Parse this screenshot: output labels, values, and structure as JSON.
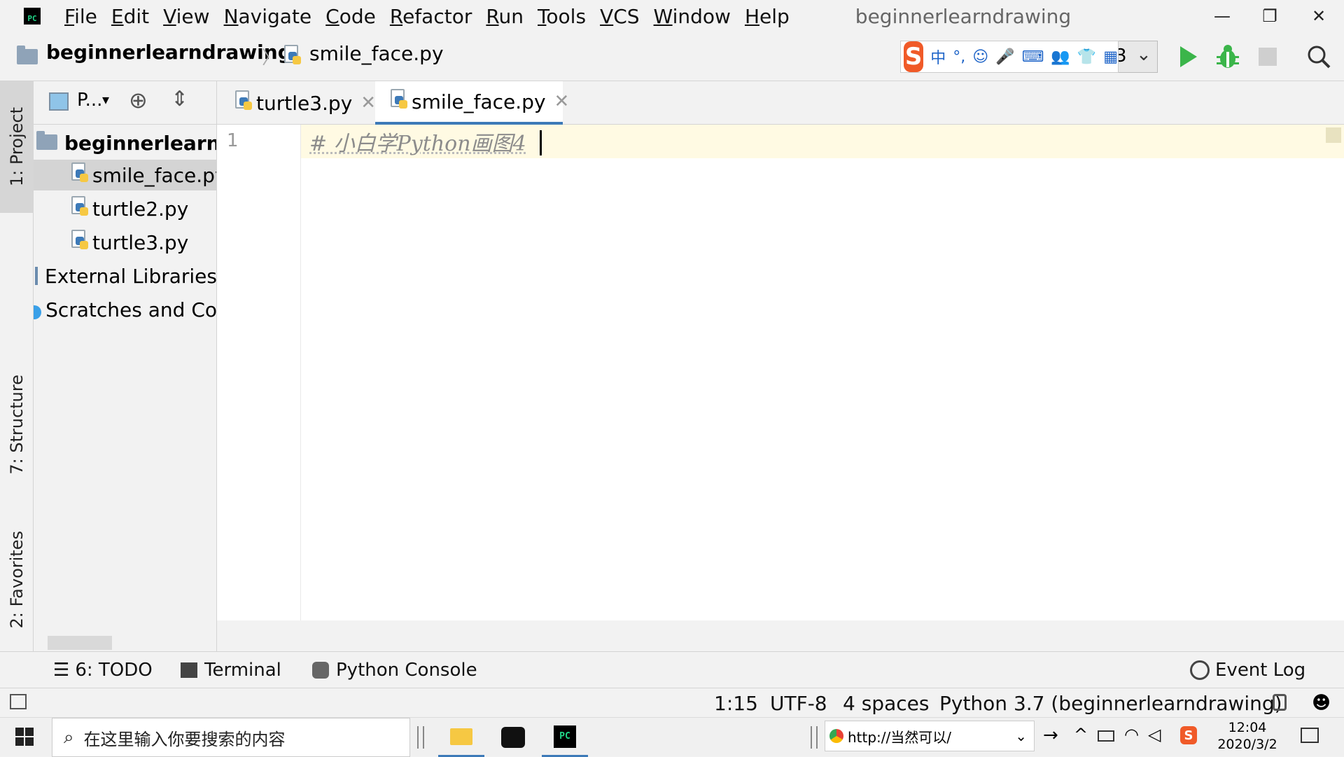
{
  "app": {
    "logo_text": "PC",
    "window_title": "beginnerlearndrawing"
  },
  "menu": {
    "items": [
      "File",
      "Edit",
      "View",
      "Navigate",
      "Code",
      "Refactor",
      "Run",
      "Tools",
      "VCS",
      "Window",
      "Help"
    ]
  },
  "window_controls": {
    "minimize": "—",
    "restore": "❐",
    "close": "✕"
  },
  "navbar": {
    "project": "beginnerlearndrawing",
    "file": "smile_face.py"
  },
  "ime": {
    "logo": "S",
    "buttons": [
      "中",
      "°,",
      "☺",
      "🎤",
      "⌨",
      "👥",
      "👕",
      "▦"
    ]
  },
  "toolbar": {
    "run_config_fragment": "3",
    "run_icon": "play-icon",
    "debug_icon": "bug-icon",
    "stop_icon": "stop-icon",
    "search_icon": "search-icon"
  },
  "left_strip": {
    "tabs": [
      "1: Project",
      "7: Structure",
      "2: Favorites"
    ]
  },
  "project_panel": {
    "header_label": "P...",
    "root": "beginnerlearndr",
    "files": [
      "smile_face.py",
      "turtle2.py",
      "turtle3.py"
    ],
    "selected_file": "smile_face.py",
    "external": "External Libraries",
    "scratches": "Scratches and Co"
  },
  "editor": {
    "tabs": [
      {
        "label": "turtle3.py",
        "active": false
      },
      {
        "label": "smile_face.py",
        "active": true
      }
    ],
    "line_number": "1",
    "code": "# 小白学Python画图4"
  },
  "bottom_tools": {
    "todo": "6: TODO",
    "terminal": "Terminal",
    "python_console": "Python Console",
    "event_log": "Event Log"
  },
  "status": {
    "position": "1:15",
    "encoding": "UTF-8",
    "indent": "4 spaces",
    "interpreter": "Python 3.7 (beginnerlearndrawing)"
  },
  "taskbar": {
    "search_placeholder": "在这里输入你要搜索的内容",
    "url": "http://当然可以/",
    "ime_tray": "S",
    "time": "12:04",
    "date": "2020/3/2"
  },
  "colors": {
    "accent_blue": "#3d7ab8",
    "run_green": "#3bb54a",
    "line_highlight": "#fffae3",
    "sogou_orange": "#f05a28"
  }
}
